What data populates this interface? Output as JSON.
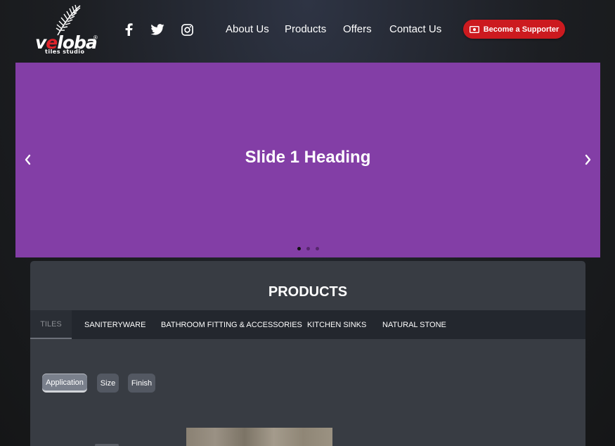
{
  "brand": {
    "name_prefix": "v",
    "name_red": "e",
    "name_suffix": "loba",
    "registered": "®",
    "tagline": "tiles studio",
    "accent_red": "#e0232a"
  },
  "social": [
    {
      "name": "facebook-icon"
    },
    {
      "name": "twitter-icon"
    },
    {
      "name": "instagram-icon"
    }
  ],
  "nav": {
    "items": [
      "About Us",
      "Products",
      "Offers",
      "Contact Us"
    ]
  },
  "supporter_button": {
    "label": "Become a Supporter",
    "icon": "money-bill-icon",
    "color": "#cc1a1f"
  },
  "slider": {
    "heading": "Slide 1 Heading",
    "background": "#833ea6",
    "slide_count": 3,
    "active_slide": 1
  },
  "products": {
    "title": "PRODUCTS",
    "tabs": [
      "TILES",
      "SANITERYWARE",
      "BATHROOM FITTING & ACCESSORIES",
      "KITCHEN SINKS",
      "NATURAL STONE"
    ],
    "active_tab": "TILES",
    "filters": [
      "Application",
      "Size",
      "Finish"
    ],
    "active_filter": "Application"
  }
}
